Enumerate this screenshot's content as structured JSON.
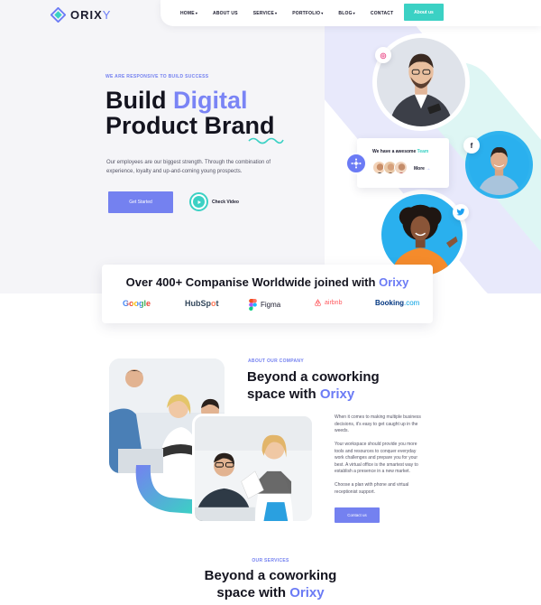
{
  "brand": {
    "logo_main": "ORIX",
    "logo_y": "Y"
  },
  "nav": {
    "items": [
      {
        "label": "HOME",
        "caret": true
      },
      {
        "label": "ABOUT US",
        "caret": false
      },
      {
        "label": "SERVICE",
        "caret": true
      },
      {
        "label": "PORTFOLIO",
        "caret": true
      },
      {
        "label": "BLOG",
        "caret": true
      },
      {
        "label": "CONTACT",
        "caret": false
      }
    ],
    "cta": "About us"
  },
  "hero": {
    "eyebrow": "WE ARE RESPONSIVE TO BUILD SUCCESS",
    "title_line1_a": "Build ",
    "title_line1_b": "Digital",
    "title_line2": "Product Brand",
    "description": "Our employees are our biggest strength. Through the combination of experience, loyalty and up-and-coming young prospects.",
    "primary_button": "Get Started",
    "video_button": "Check Video"
  },
  "team_card": {
    "title_a": "We have a awesome ",
    "title_b": "Team",
    "more": "More",
    "more_arrow": "→"
  },
  "companies": {
    "title_a": "Over 400+ Companise Worldwide joined with ",
    "title_b": "Orixy",
    "logos": {
      "google": "Google",
      "hubspot_a": "HubSp",
      "hubspot_b": "o",
      "hubspot_c": "t",
      "figma": "Figma",
      "airbnb": "airbnb",
      "booking_a": "Booking",
      "booking_b": ".com"
    }
  },
  "about": {
    "eyebrow": "ABOUT OUR COMPANY",
    "title_line1": "Beyond a coworking",
    "title_line2_a": "space with ",
    "title_line2_b": "Orixy",
    "paragraphs": [
      "When it comes to making multiple business decisions, it's easy to get caught up in the weeds.",
      "Your workspace should provide you more tools and resources to conquer everyday work challenges and prepare you for your best. A virtual office is the smartest way to establish a presence in a new market.",
      "Choose a plan with phone and virtual receptionist support."
    ],
    "button": "Contact us"
  },
  "services": {
    "eyebrow": "OUR SERVICES",
    "title_line1": "Beyond a coworking",
    "title_line2_a": "space with ",
    "title_line2_b": "Orixy"
  },
  "colors": {
    "primary": "#7481f0",
    "accent_teal": "#3bd1c4",
    "heading": "#14141f"
  }
}
